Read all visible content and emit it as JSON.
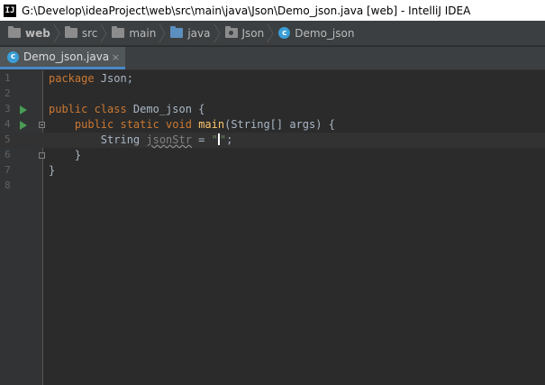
{
  "window": {
    "title": "G:\\Develop\\ideaProject\\web\\src\\main\\java\\Json\\Demo_json.java [web] - IntelliJ IDEA",
    "app_icon": "IJ"
  },
  "breadcrumb": [
    {
      "label": "web",
      "icon": "project-folder-icon"
    },
    {
      "label": "src",
      "icon": "folder-icon"
    },
    {
      "label": "main",
      "icon": "folder-icon"
    },
    {
      "label": "java",
      "icon": "source-folder-icon"
    },
    {
      "label": "Json",
      "icon": "package-icon"
    },
    {
      "label": "Demo_json",
      "icon": "class-icon"
    }
  ],
  "tabs": [
    {
      "label": "Demo_json.java",
      "icon": "class-icon",
      "active": true
    }
  ],
  "editor": {
    "line_numbers": [
      "1",
      "2",
      "3",
      "4",
      "5",
      "6",
      "7",
      "8"
    ],
    "lines": {
      "l1_kw": "package",
      "l1_rest": " Json;",
      "l3_kw": "public class",
      "l3_rest": " Demo_json {",
      "l4_indent": "    ",
      "l4_kw": "public static void",
      "l4_sp": " ",
      "l4_fn": "main",
      "l4_rest": "(String[] args) {",
      "l5_indent": "        ",
      "l5_type": "String ",
      "l5_var": "jsonStr",
      "l5_eq": " = ",
      "l5_str": "\"",
      "l5_end": ";",
      "l6": "    }",
      "l7": "}"
    },
    "caret_line": "5"
  },
  "colors": {
    "keyword": "#cc7832",
    "method": "#ffc66d",
    "string": "#6a8759",
    "text": "#a9b7c6",
    "run_marker": "#499c54"
  }
}
